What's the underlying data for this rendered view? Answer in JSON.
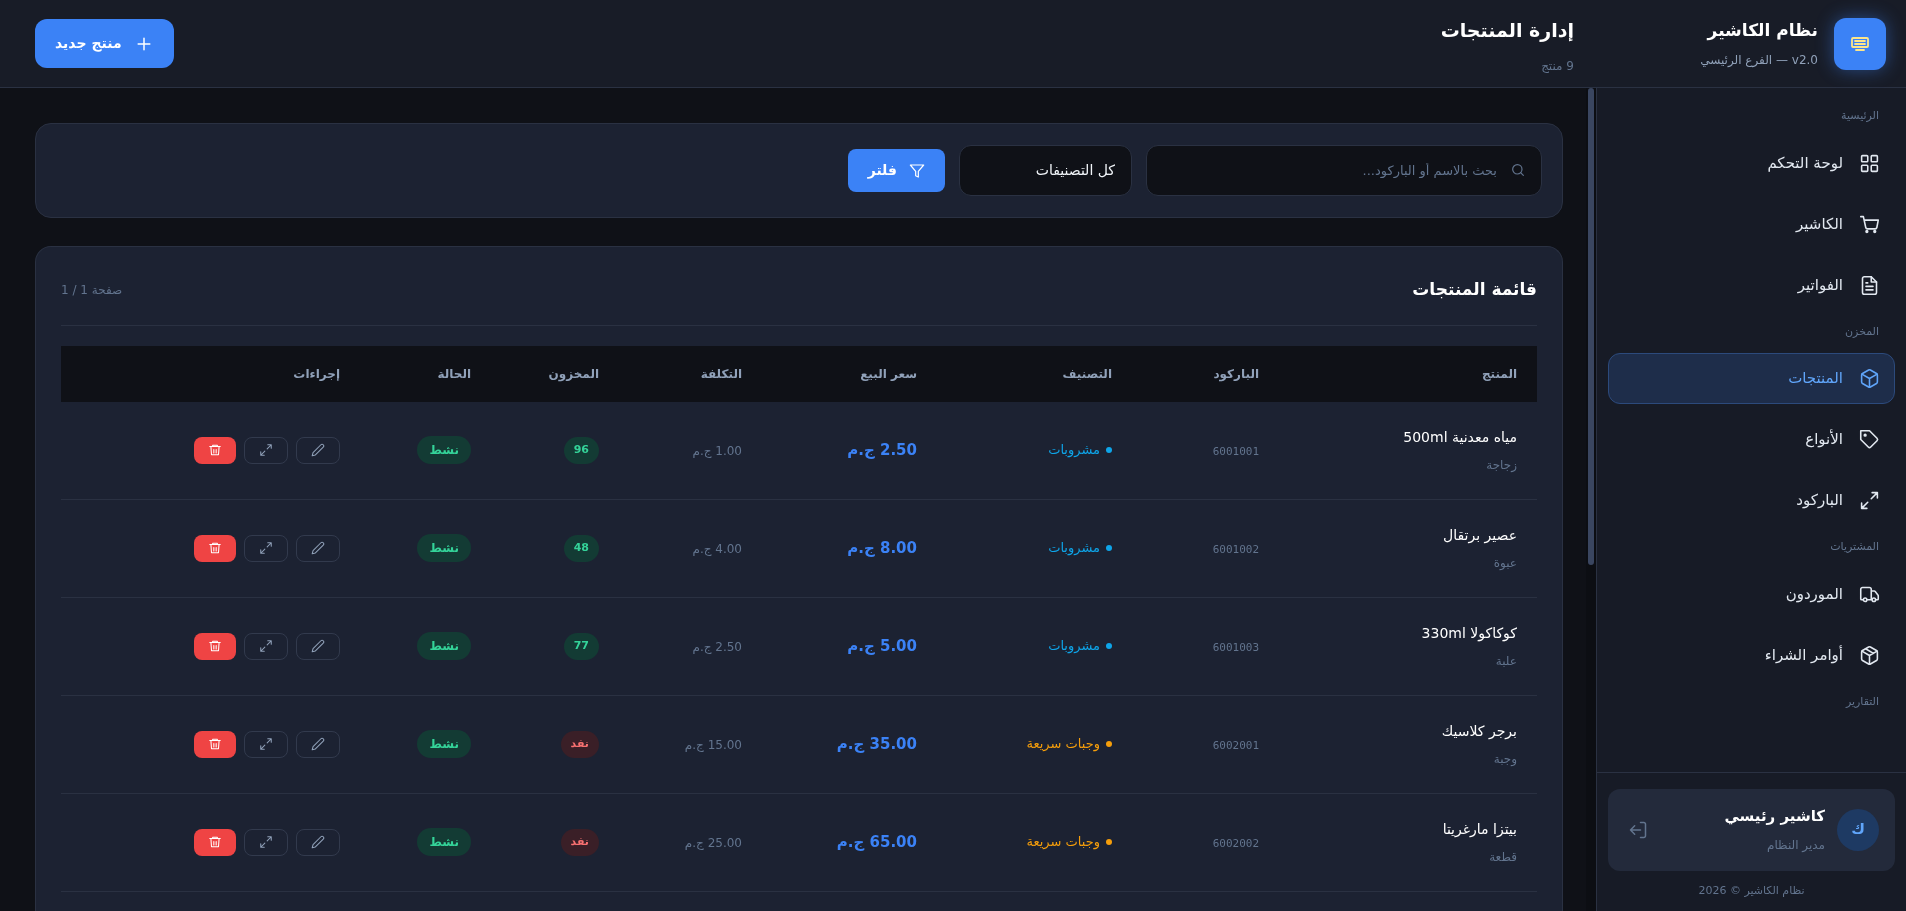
{
  "brand": {
    "title": "نظام الكاشير",
    "subtitle": "v2.0 — الفرع الرئيسي"
  },
  "page": {
    "title": "إدارة المنتجات",
    "subtitle": "9 منتج",
    "new_button": "منتج جديد"
  },
  "filters": {
    "search_placeholder": "بحث بالاسم أو الباركود...",
    "category_select": "كل التصنيفات",
    "filter_button": "فلتر"
  },
  "sidebar": {
    "sections": [
      {
        "label": "الرئيسية",
        "items": [
          {
            "label": "لوحة التحكم",
            "selected": false
          },
          {
            "label": "الكاشير",
            "selected": false
          },
          {
            "label": "الفواتير",
            "selected": false
          }
        ]
      },
      {
        "label": "المخزن",
        "items": [
          {
            "label": "المنتجات",
            "selected": true
          },
          {
            "label": "الأنواع",
            "selected": false
          },
          {
            "label": "الباركود",
            "selected": false
          }
        ]
      },
      {
        "label": "المشتريات",
        "items": [
          {
            "label": "الموردون",
            "selected": false
          },
          {
            "label": "أوامر الشراء",
            "selected": false
          }
        ]
      },
      {
        "label": "التقارير"
      }
    ],
    "user": {
      "avatar": "ك",
      "name": "كاشير رئيسي",
      "role": "مدير النظام"
    },
    "copyright": "نظام الكاشير © 2026"
  },
  "table": {
    "title": "قائمة المنتجات",
    "pagination": "صفحة 1 / 1",
    "columns": [
      "المنتج",
      "الباركود",
      "التصنيف",
      "سعر البيع",
      "التكلفة",
      "المخزون",
      "الحالة",
      "إجراءات"
    ],
    "rows": [
      {
        "name": "مياه معدنية 500ml",
        "unit": "زجاجة",
        "barcode": "6001001",
        "category": "مشروبات",
        "color": "#0ea5e9",
        "price": "2.50 ج.م",
        "cost": "1.00 ج.م",
        "stock": "96",
        "out_of_stock": false,
        "status": "نشط"
      },
      {
        "name": "عصير برتقال",
        "unit": "عبوة",
        "barcode": "6001002",
        "category": "مشروبات",
        "color": "#0ea5e9",
        "price": "8.00 ج.م",
        "cost": "4.00 ج.م",
        "stock": "48",
        "out_of_stock": false,
        "status": "نشط"
      },
      {
        "name": "كوكاكولا 330ml",
        "unit": "علبة",
        "barcode": "6001003",
        "category": "مشروبات",
        "color": "#0ea5e9",
        "price": "5.00 ج.م",
        "cost": "2.50 ج.م",
        "stock": "77",
        "out_of_stock": false,
        "status": "نشط"
      },
      {
        "name": "برجر كلاسيك",
        "unit": "وجبة",
        "barcode": "6002001",
        "category": "وجبات سريعة",
        "color": "#f59e0b",
        "price": "35.00 ج.م",
        "cost": "15.00 ج.م",
        "stock": "نفد",
        "out_of_stock": true,
        "status": "نشط"
      },
      {
        "name": "بيتزا مارغريتا",
        "unit": "قطعة",
        "barcode": "6002002",
        "category": "وجبات سريعة",
        "color": "#f59e0b",
        "price": "65.00 ج.م",
        "cost": "25.00 ج.م",
        "stock": "نفد",
        "out_of_stock": true,
        "status": "نشط"
      }
    ]
  }
}
